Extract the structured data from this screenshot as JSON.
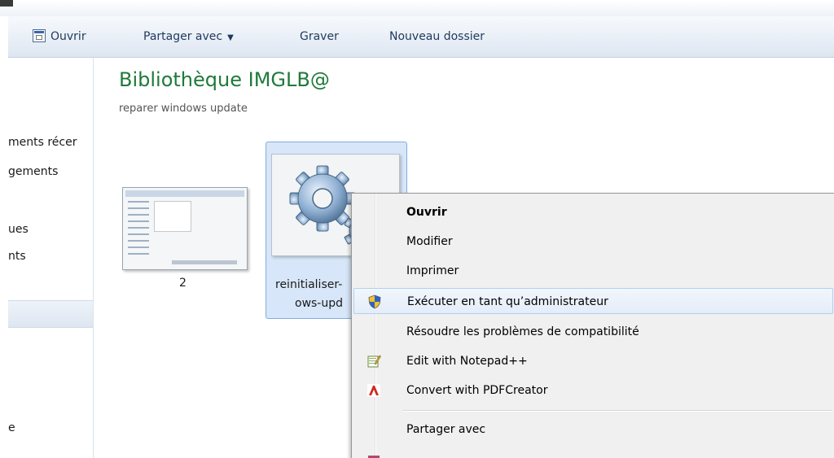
{
  "toolbar": {
    "open_label": "Ouvrir",
    "share_label": "Partager avec",
    "burn_label": "Graver",
    "new_folder_label": "Nouveau dossier"
  },
  "nav": {
    "items": [
      "ments récer",
      "gements",
      "ues",
      "nts",
      "e"
    ]
  },
  "library": {
    "title": "Bibliothèque IMGLB@",
    "subtitle": "reparer windows update"
  },
  "files": [
    {
      "name": "2"
    },
    {
      "name_line1": "reinitialiser-",
      "name_line2": "ows-upd"
    }
  ],
  "context_menu": {
    "items": [
      {
        "label": "Ouvrir",
        "bold": true
      },
      {
        "label": "Modifier"
      },
      {
        "label": "Imprimer"
      },
      {
        "label": "Exécuter en tant qu’administrateur",
        "icon": "uac-shield-icon",
        "highlighted": true
      },
      {
        "label": "Résoudre les problèmes de compatibilité"
      },
      {
        "label": "Edit with Notepad++",
        "icon": "notepad-plus-plus-icon"
      },
      {
        "label": "Convert with PDFCreator",
        "icon": "pdfcreator-icon"
      },
      {
        "label": "Partager avec"
      }
    ]
  },
  "colors": {
    "library_title": "#1f7a3a",
    "selection_bg": "#d7e6f9",
    "menu_bg": "#f0f0f0"
  }
}
